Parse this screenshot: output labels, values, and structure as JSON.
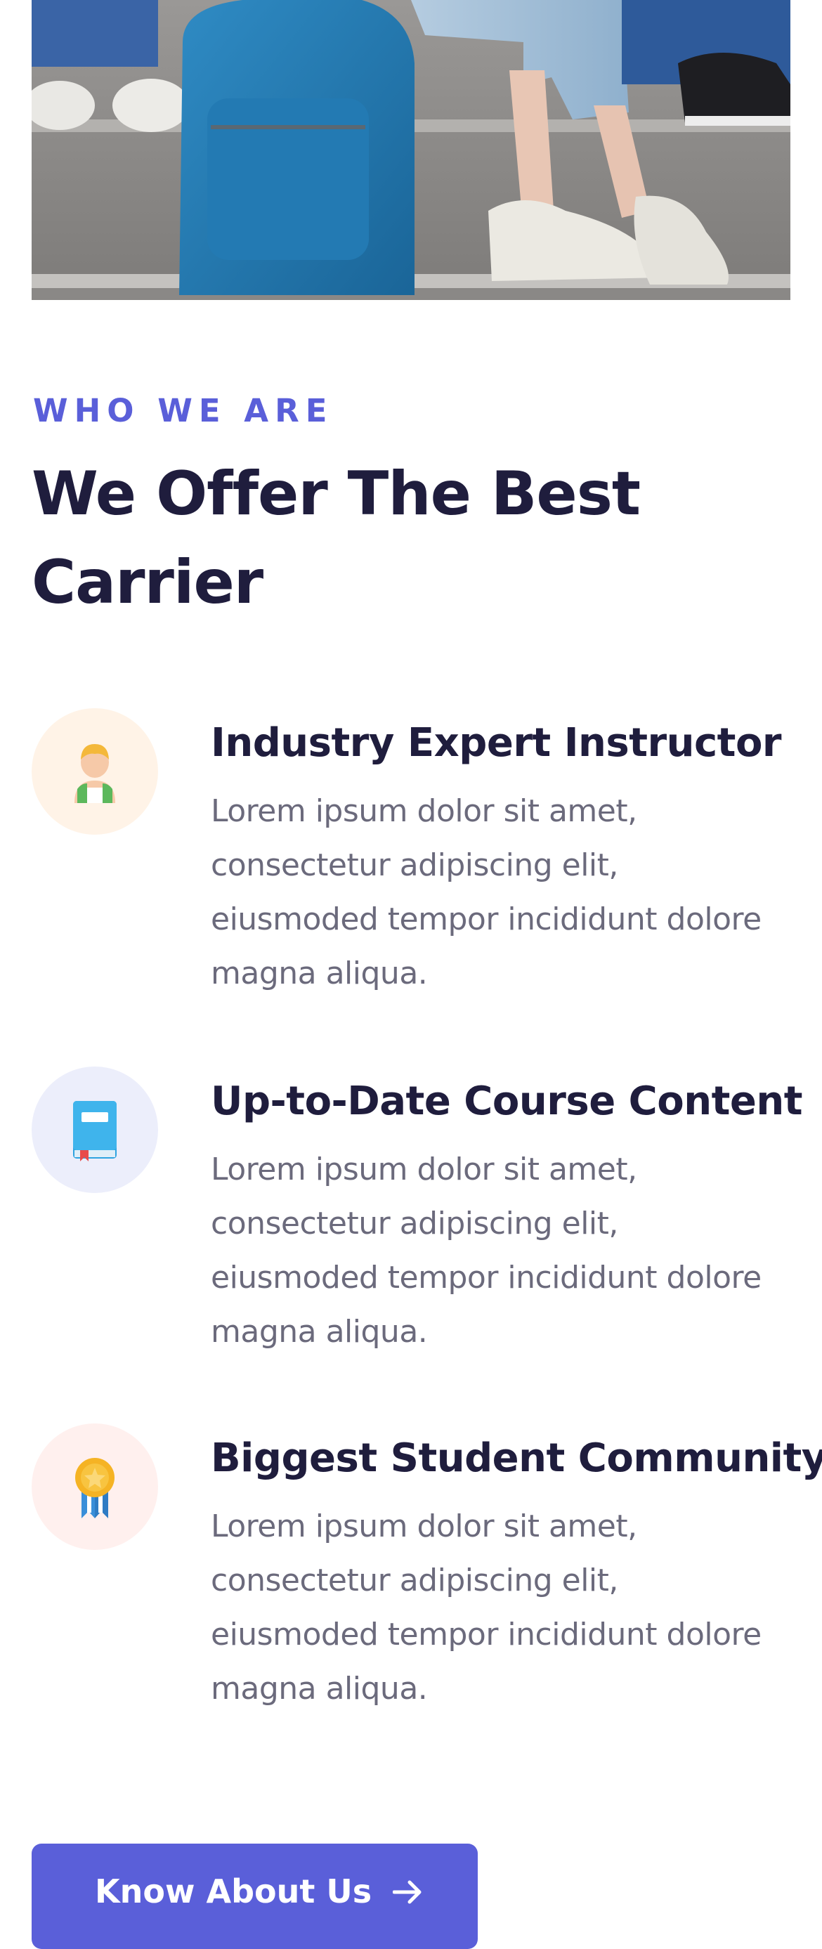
{
  "hero": {
    "image_alt": "students sitting on steps with a blue backpack"
  },
  "section": {
    "eyebrow": "WHO WE ARE",
    "title_line1": "We Offer The Best",
    "title_line2": "Carrier"
  },
  "features": [
    {
      "icon": "instructor-icon",
      "icon_bg": "#fff3e7",
      "title": "Industry Expert Instructor",
      "text": "Lorem ipsum dolor sit amet, consectetur adipiscing elit, eiusmoded tempor incididunt dolore magna aliqua."
    },
    {
      "icon": "book-icon",
      "icon_bg": "#eceefb",
      "title": "Up-to-Date Course Content",
      "text": "Lorem ipsum dolor sit amet, consectetur adipiscing elit, eiusmoded tempor incididunt dolore magna aliqua."
    },
    {
      "icon": "medal-icon",
      "icon_bg": "#fff0ee",
      "title": "Biggest Student Community",
      "text": "Lorem ipsum dolor sit amet, consectetur adipiscing elit, eiusmoded tempor incididunt dolore magna aliqua."
    }
  ],
  "cta": {
    "label": "Know About Us",
    "icon": "arrow-right-icon"
  },
  "colors": {
    "accent": "#5a5fd9",
    "heading": "#1f1d3d",
    "body_text": "#6b6a7c"
  }
}
